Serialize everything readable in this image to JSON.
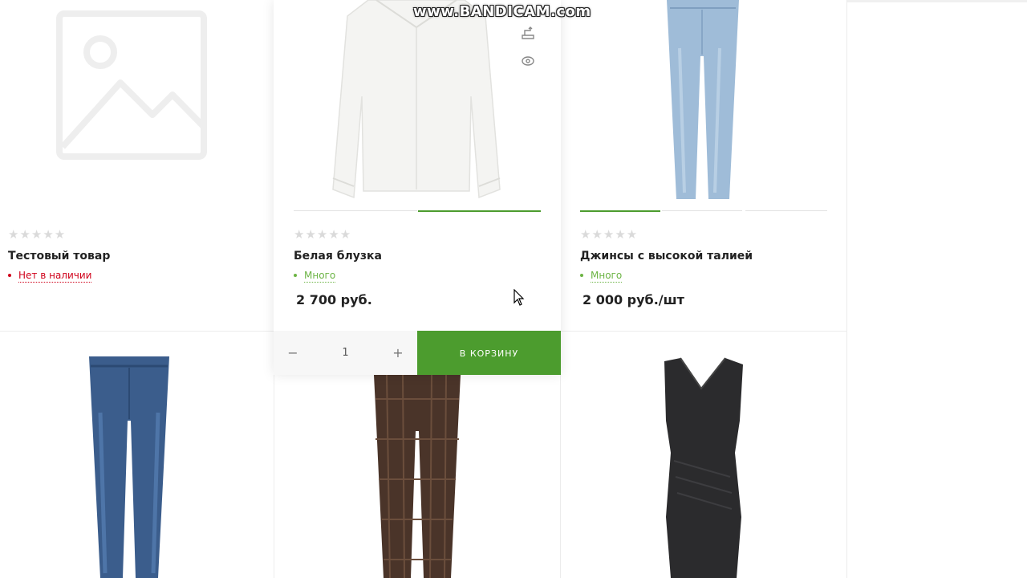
{
  "watermark": "www.BANDICAM.com",
  "products": [
    {
      "title": "Тестовый товар",
      "rating": "★★★★★",
      "stock": "Нет в наличии",
      "stock_color": "#d0021b",
      "price": "",
      "image": "placeholder-image-icon"
    },
    {
      "title": "Белая блузка",
      "rating": "★★★★★",
      "stock": "Много",
      "stock_color": "#6cb444",
      "price": "2 700 руб.",
      "image": "white-blouse"
    },
    {
      "title": "Джинсы с высокой талией",
      "rating": "★★★★★",
      "stock": "Много",
      "stock_color": "#6cb444",
      "price": "2 000 руб./шт",
      "image": "light-jeans"
    }
  ],
  "cart": {
    "quantity": "1",
    "minus_label": "−",
    "plus_label": "+",
    "button_label": "В КОРЗИНУ"
  },
  "colors": {
    "accent": "#4c9c2e",
    "out_of_stock": "#d0021b",
    "in_stock": "#6cb444"
  },
  "lower_row_images": [
    "dark-jeans",
    "plaid-trousers",
    "black-dress"
  ]
}
